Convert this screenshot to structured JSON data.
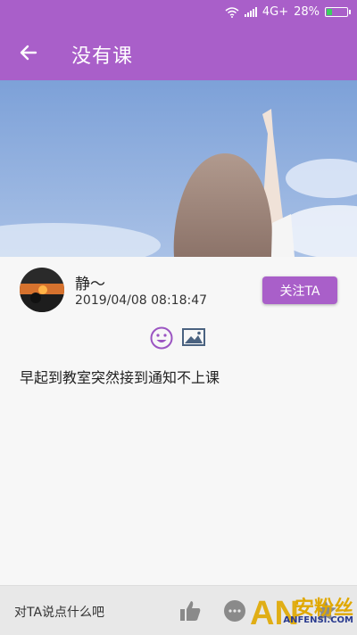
{
  "status": {
    "network": "4G+",
    "battery": "28%",
    "battery_level": 0.28
  },
  "appbar": {
    "title": "没有课"
  },
  "post": {
    "author": "静～",
    "date": "2019/04/08 08:18:47",
    "follow_label": "关注TA",
    "content": "早起到教室突然接到通知不上课"
  },
  "bottom": {
    "comment_placeholder": "对TA说点什么吧"
  },
  "watermark": {
    "text": "安粉丝",
    "sub": "ANFENSI.COM",
    "logo": "AN"
  },
  "colors": {
    "accent": "#a95fc9",
    "watermark_gold": "#e0a800"
  }
}
